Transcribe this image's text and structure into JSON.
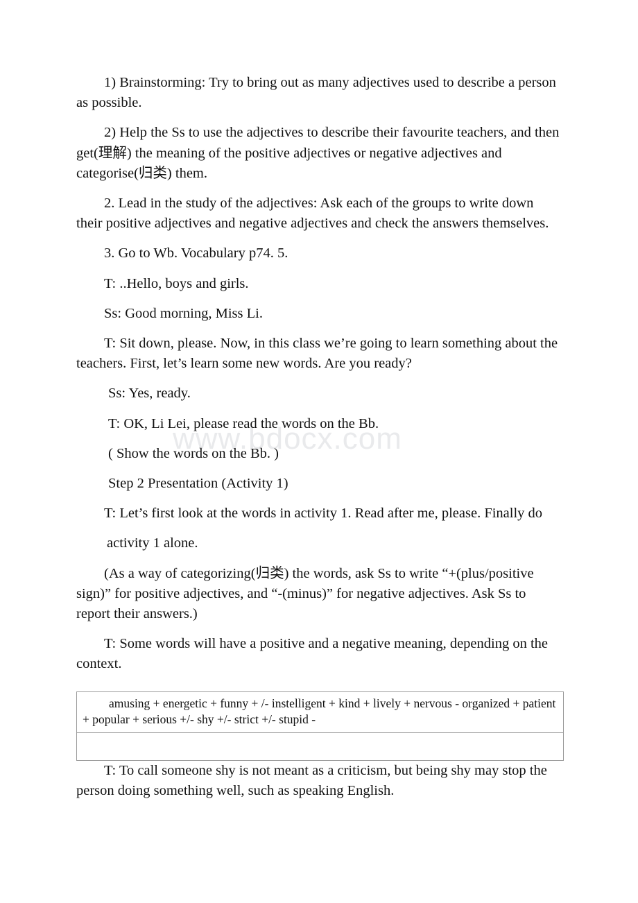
{
  "document": {
    "watermark": "www.bdocx.com",
    "body_paragraphs": [
      {
        "id": "brainstorming",
        "text": "1) Brainstorming: Try to bring out as many adjectives used to describe a person as possible.",
        "indent": "normal"
      },
      {
        "id": "help-ss",
        "text": "2) Help the Ss to use the adjectives to describe their favourite teachers, and then get(理解) the meaning of the positive adjectives or negative adjectives and categorise(归类) them.",
        "indent": "normal"
      },
      {
        "id": "lead-in",
        "text": "2. Lead in the study of the adjectives: Ask each of the groups to write down their positive adjectives and negative adjectives and check the answers themselves.",
        "indent": "normal"
      },
      {
        "id": "go-to-wb",
        "text": "3. Go to Wb. Vocabulary p74. 5.",
        "indent": "normal"
      },
      {
        "id": "t-hello",
        "text": "T: ..Hello, boys and girls.",
        "indent": "normal"
      },
      {
        "id": "ss-good-morning",
        "text": "Ss: Good morning, Miss Li.",
        "indent": "normal"
      },
      {
        "id": "t-sit-down",
        "text": "T: Sit down, please. Now, in this class we’re going to learn something about the teachers. First, let’s learn some new words. Are you ready?",
        "indent": "normal"
      },
      {
        "id": "ss-yes-ready",
        "text": " Ss: Yes, ready.",
        "indent": "small"
      },
      {
        "id": "t-ok-li-lei",
        "text": " T: OK, Li Lei, please read the words on the Bb.",
        "indent": "small"
      },
      {
        "id": "show-words",
        "text": " ( Show the words on the Bb. )",
        "indent": "small"
      },
      {
        "id": "step-2-presentation",
        "text": " Step 2 Presentation (Activity 1)",
        "indent": "small"
      },
      {
        "id": "t-lets-first-look",
        "text": "T: Let’s first look at the words in activity 1. Read after me, please. Finally do",
        "indent": "normal"
      },
      {
        "id": "activity-1-alone",
        "text": "activity 1 alone.",
        "indent": "cont"
      },
      {
        "id": "categorizing-note",
        "text": "(As a way of categorizing(归类) the words, ask Ss to write “+(plus/positive sign)” for positive adjectives, and “-(minus)” for negative adjectives. Ask Ss to report their answers.)",
        "indent": "normal"
      },
      {
        "id": "t-some-words",
        "text": "T: Some words will have a positive and a negative meaning, depending on the context.",
        "indent": "normal"
      }
    ],
    "word_table": {
      "rows": [
        {
          "id": "adjectives-row",
          "text": "amusing + energetic + funny + /- instelligent + kind + lively + nervous - organized + patient + popular + serious +/- shy +/- strict +/- stupid -"
        },
        {
          "id": "empty-row",
          "text": ""
        }
      ]
    },
    "closing_paragraphs": [
      {
        "id": "t-criticism",
        "text": "T: To call someone shy is not meant as a criticism, but being shy may stop the person doing something well, such as speaking English.",
        "indent": "normal"
      }
    ]
  }
}
